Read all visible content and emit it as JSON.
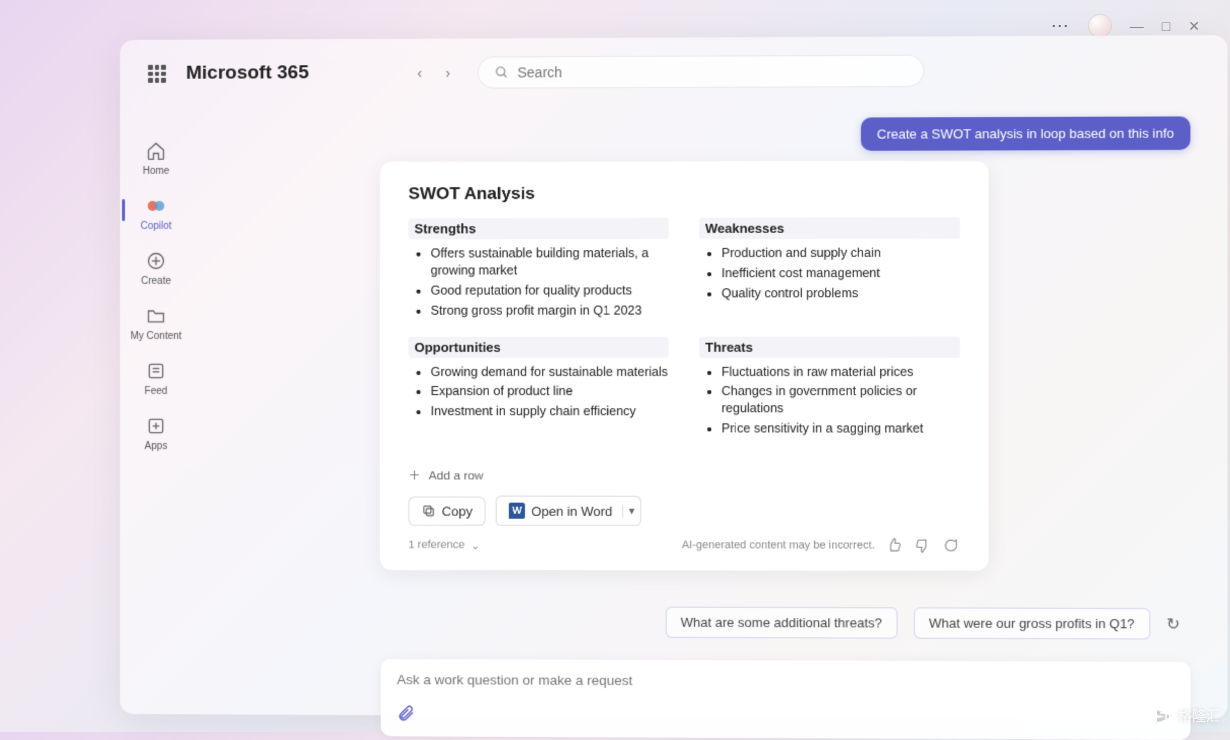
{
  "brand": "Microsoft 365",
  "search": {
    "placeholder": "Search"
  },
  "rail": {
    "items": [
      {
        "label": "Home"
      },
      {
        "label": "Copilot"
      },
      {
        "label": "Create"
      },
      {
        "label": "My Content"
      },
      {
        "label": "Feed"
      },
      {
        "label": "Apps"
      }
    ]
  },
  "chat": {
    "user_message": "Create a SWOT analysis in loop based on this info",
    "card": {
      "title": "SWOT Analysis",
      "strengths_label": "Strengths",
      "strengths": [
        "Offers sustainable building materials, a growing market",
        "Good reputation for quality products",
        "Strong gross profit margin in Q1 2023"
      ],
      "weaknesses_label": "Weaknesses",
      "weaknesses": [
        "Production and supply chain",
        "Inefficient cost management",
        "Quality control problems"
      ],
      "opportunities_label": "Opportunities",
      "opportunities": [
        "Growing demand for sustainable materials",
        "Expansion of product line",
        "Investment in supply chain efficiency"
      ],
      "threats_label": "Threats",
      "threats": [
        "Fluctuations in raw material prices",
        "Changes in government policies or regulations",
        "Price sensitivity in a sagging market"
      ],
      "add_row": "Add a row",
      "copy_label": "Copy",
      "open_word_label": "Open in Word",
      "disclaimer": "AI-generated content may be incorrect.",
      "reference_label": "1 reference"
    },
    "suggestions": [
      "What are some additional threats?",
      "What were our gross profits in Q1?"
    ],
    "composer_placeholder": "Ask a work question or make a request"
  },
  "watermark": "格隆汇"
}
